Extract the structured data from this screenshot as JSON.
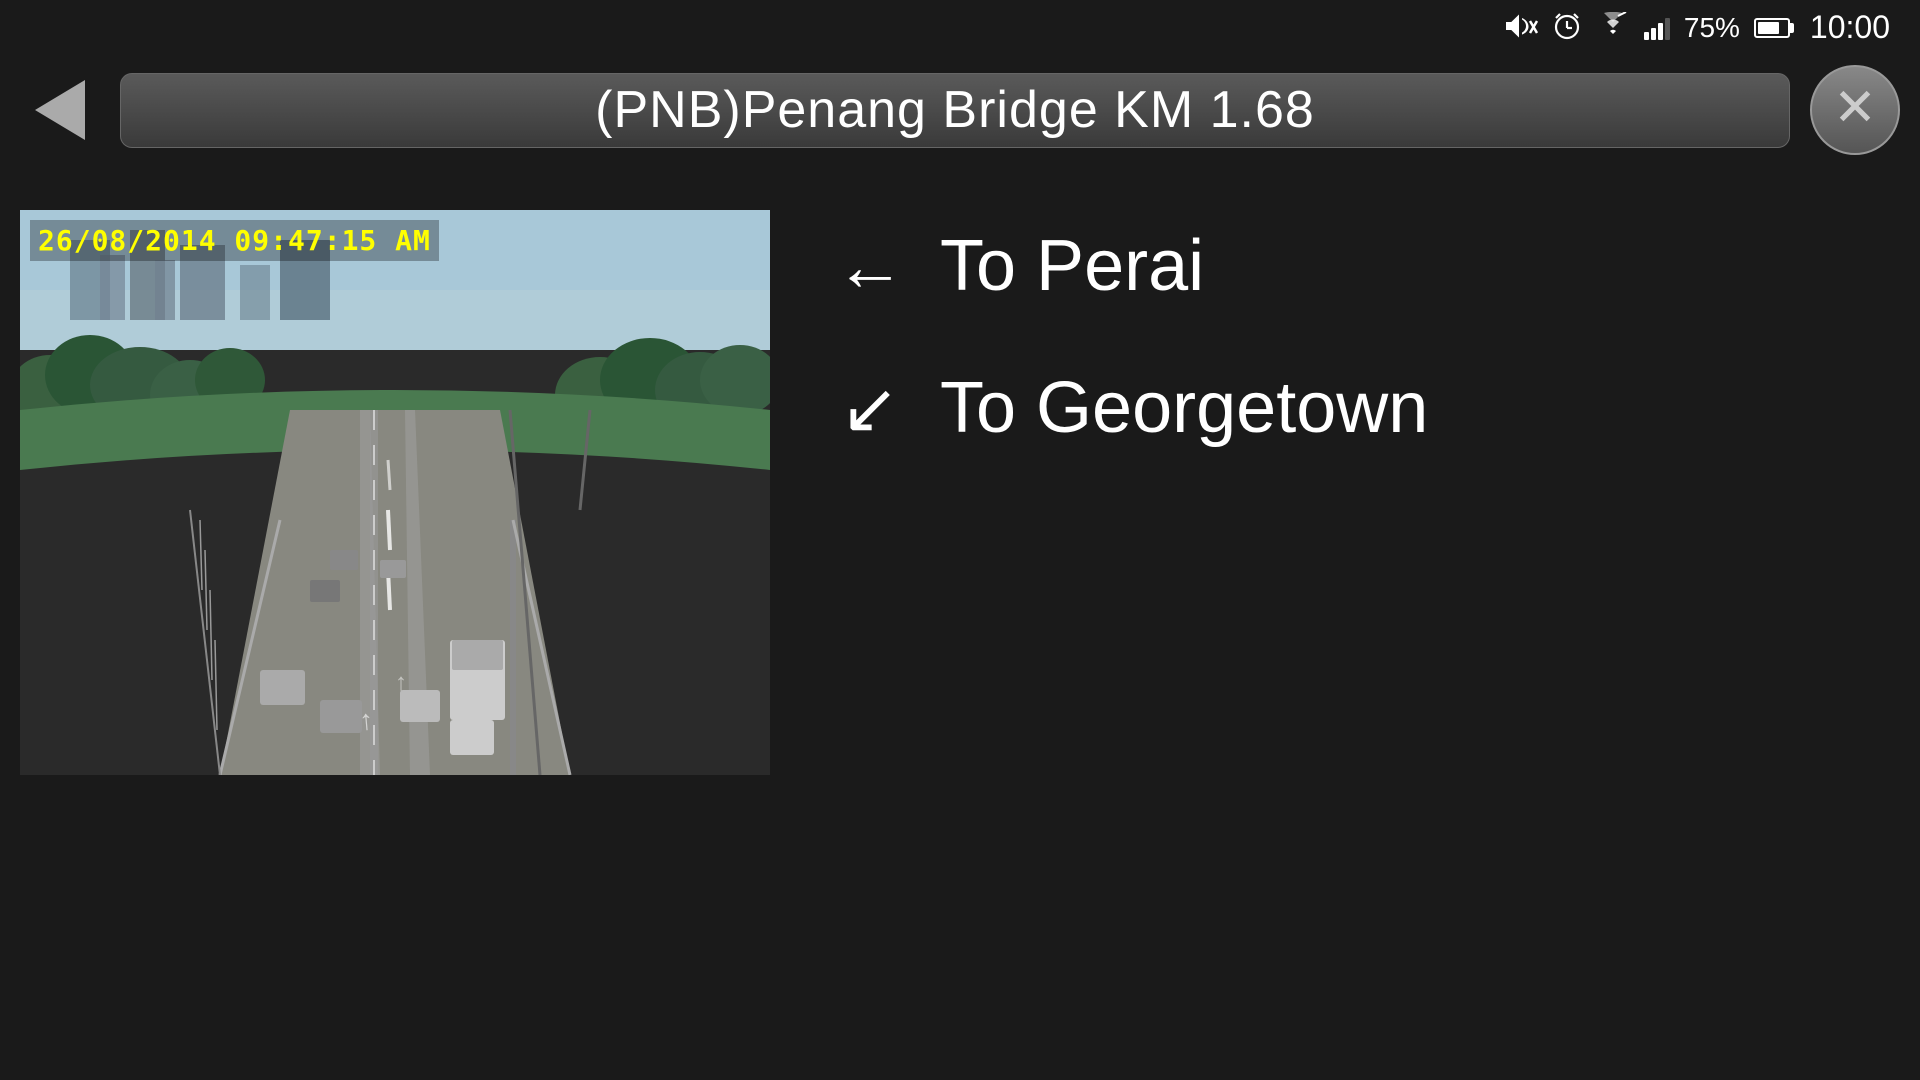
{
  "status_bar": {
    "battery_percent": "75%",
    "time": "10:00",
    "icons": {
      "mute": "🔇",
      "alarm": "⏰"
    }
  },
  "header": {
    "title": "(PNB)Penang Bridge KM 1.68",
    "back_label": "‹",
    "close_label": "✕"
  },
  "camera": {
    "timestamp": "26/08/2014 09:47:15 AM"
  },
  "directions": [
    {
      "id": "to-perai",
      "arrow": "←",
      "label": "To Perai"
    },
    {
      "id": "to-georgetown",
      "arrow": "↙",
      "label": "To Georgetown"
    }
  ]
}
